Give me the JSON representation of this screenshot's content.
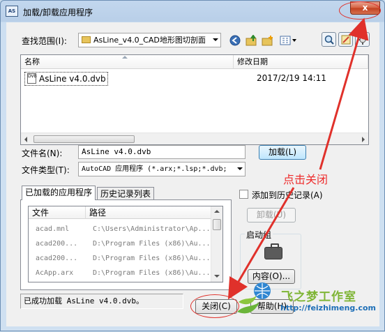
{
  "window": {
    "title": "加载/卸载应用程序",
    "app_icon_text": "AS",
    "close_label": "x"
  },
  "lookin": {
    "label": "查找范围(I):",
    "value": "AsLine_v4.0_CAD地形图切剖面"
  },
  "toolbar": {
    "icons": [
      "back-icon",
      "up-folder-icon",
      "new-folder-icon",
      "views-icon",
      "find-icon",
      "tools-icon",
      "options-icon"
    ]
  },
  "file_list": {
    "columns": [
      "名称",
      "修改日期"
    ],
    "rows": [
      {
        "name": "AsLine v4.0.dvb",
        "date": "2017/2/19 14:11"
      }
    ]
  },
  "file_name": {
    "label": "文件名(N):",
    "value": "AsLine v4.0.dvb"
  },
  "load_button": "加载(L)",
  "file_type": {
    "label": "文件类型(T):",
    "value": "AutoCAD 应用程序 (*.arx;*.lsp;*.dvb;"
  },
  "tabs": [
    "已加载的应用程序",
    "历史记录列表"
  ],
  "loaded_apps": {
    "columns": [
      "文件",
      "路径"
    ],
    "rows": [
      {
        "file": "acad.mnl",
        "path": "C:\\Users\\Administrator\\Ap..."
      },
      {
        "file": "acad200...",
        "path": "D:\\Program Files (x86)\\Au..."
      },
      {
        "file": "acad200...",
        "path": "D:\\Program Files (x86)\\Au..."
      },
      {
        "file": "AcApp.arx",
        "path": "D:\\Program Files (x86)\\Au..."
      }
    ]
  },
  "add_to_history": {
    "label": "添加到历史记录(A)",
    "checked": false
  },
  "unload_button": "卸载(U)",
  "startup_suite": {
    "legend": "启动组",
    "contents_button": "内容(O)..."
  },
  "status_text": "已成功加载 AsLine v4.0.dvb。",
  "close_button": "关闭(C)",
  "help_button": "帮助(H)",
  "annotation": {
    "text": "点击关闭",
    "color": "#ee2c2c"
  },
  "watermark": {
    "title": "飞之梦工作室",
    "url": "http://feizhimeng.com"
  }
}
